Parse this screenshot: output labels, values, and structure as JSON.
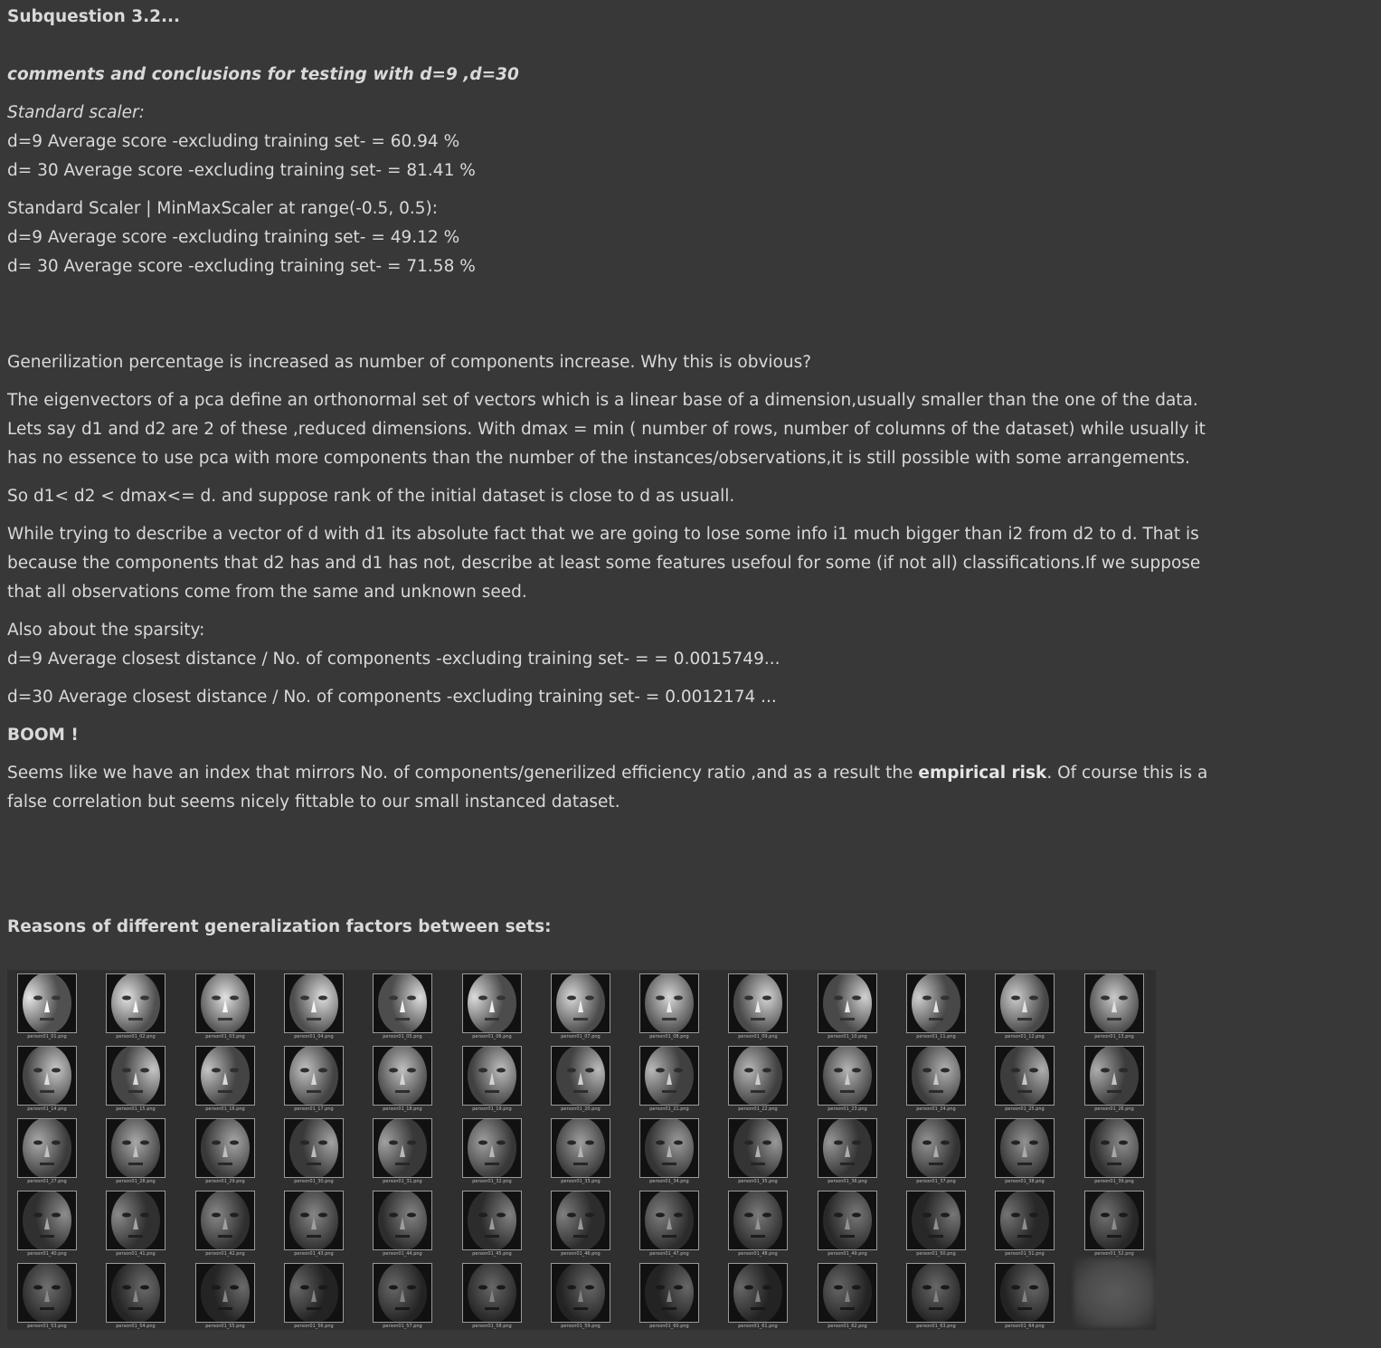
{
  "heading": "Subquestion 3.2...",
  "comments_title": "comments and conclusions for testing with d=9 ,d=30",
  "standard_scaler": {
    "label": "Standard scaler:",
    "d9": "d=9 Average score -excluding training set- = 60.94 %",
    "d30": "d= 30 Average score -excluding training set- = 81.41 %"
  },
  "minmax_scaler": {
    "label": "Standard Scaler | MinMaxScaler at range(-0.5, 0.5):",
    "d9": "d=9 Average score -excluding training set- = 49.12 %",
    "d30": "d= 30 Average score -excluding training set- = 71.58 %"
  },
  "generalization_question": "Generilization percentage is increased as number of components increase. Why this is obvious?",
  "eigen_paragraph": [
    "The eigenvectors of a pca define an orthonormal set of vectors which is a linear base of a dimension,usually smaller than the one of the data.",
    "Lets say d1 and d2 are 2 of these ,reduced dimensions. With dmax = min ( number of rows, number of columns of the dataset) while usually it",
    "has no essence to use pca with more components than the number of the instances/observations,it is still possible with some arrangements."
  ],
  "rank_line": "So d1< d2 < dmax<= d. and suppose rank of the initial dataset is close to d as usuall.",
  "describe_paragraph": [
    "While trying to describe a vector of d with d1 its absolute fact that we are going to lose some info i1 much bigger than i2 from d2 to d. That is",
    "because the components that d2 has and d1 has not, describe at least some features usefoul for some (if not all) classifications.If we suppose",
    "that all observations come from the same and unknown seed."
  ],
  "sparsity": {
    "label": "Also about the sparsity:",
    "d9": "d=9 Average closest distance / No. of components -excluding training set- = = 0.0015749...",
    "d30": "d=30 Average closest distance / No. of components -excluding training set- = 0.0012174 ..."
  },
  "boom": "BOOM !",
  "conclusion": {
    "line1_before": "Seems like we have an index that mirrors No. of components/generilized efficiency ratio ,and as a result the ",
    "line1_bold": "empirical risk",
    "line1_after": ". Of course this is a",
    "line2": "false correlation but seems nicely fittable to our small instanced dataset."
  },
  "reasons_heading": "Reasons of different generalization factors between sets:",
  "image_grid": {
    "columns": 13,
    "rows": 5,
    "labels": [
      "person01_01.png",
      "person01_02.png",
      "person01_03.png",
      "person01_04.png",
      "person01_05.png",
      "person01_06.png",
      "person01_07.png",
      "person01_08.png",
      "person01_09.png",
      "person01_10.png",
      "person01_11.png",
      "person01_12.png",
      "person01_13.png",
      "person01_14.png",
      "person01_15.png",
      "person01_16.png",
      "person01_17.png",
      "person01_18.png",
      "person01_19.png",
      "person01_20.png",
      "person01_21.png",
      "person01_22.png",
      "person01_23.png",
      "person01_24.png",
      "person01_25.png",
      "person01_26.png",
      "person01_27.png",
      "person01_28.png",
      "person01_29.png",
      "person01_30.png",
      "person01_31.png",
      "person01_32.png",
      "person01_33.png",
      "person01_34.png",
      "person01_35.png",
      "person01_36.png",
      "person01_37.png",
      "person01_38.png",
      "person01_39.png",
      "person01_40.png",
      "person01_41.png",
      "person01_42.png",
      "person01_43.png",
      "person01_44.png",
      "person01_45.png",
      "person01_46.png",
      "person01_47.png",
      "person01_48.png",
      "person01_49.png",
      "person01_50.png",
      "person01_51.png",
      "person01_52.png",
      "person01_53.png",
      "person01_54.png",
      "person01_55.png",
      "person01_56.png",
      "person01_57.png",
      "person01_58.png",
      "person01_59.png",
      "person01_60.png",
      "person01_61.png",
      "person01_62.png",
      "person01_63.png",
      "person01_64.png"
    ]
  }
}
